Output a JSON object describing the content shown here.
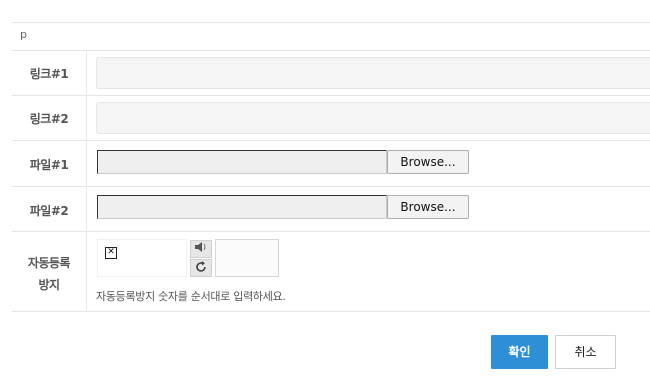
{
  "form": {
    "p_text": "p",
    "link1_label": "링크#1",
    "link2_label": "링크#2",
    "file1_label": "파일#1",
    "file2_label": "파일#2",
    "browse_label": "Browse...",
    "captcha_label_line1": "자동등록",
    "captcha_label_line2": "방지",
    "captcha_help": "자동등록방지 숫자를 순서대로 입력하세요.",
    "audio_icon": "speaker-icon",
    "refresh_icon": "refresh-icon"
  },
  "buttons": {
    "ok": "확인",
    "cancel": "취소"
  },
  "colors": {
    "accent": "#2f8fd6"
  }
}
